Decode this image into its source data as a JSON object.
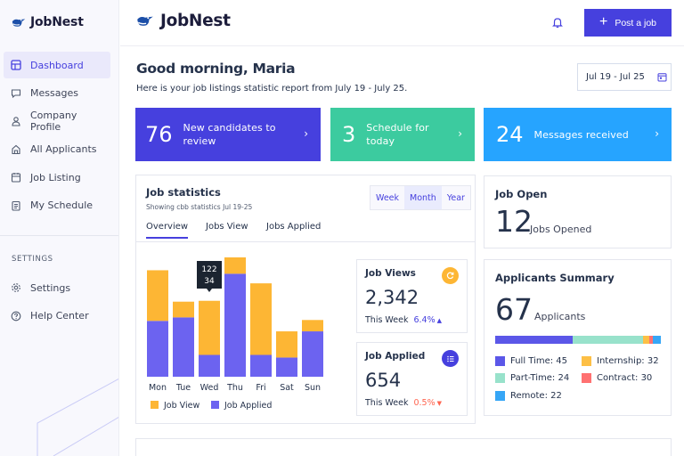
{
  "app": {
    "name": "JobNest"
  },
  "sidebar": {
    "items": [
      {
        "label": "Dashboard",
        "icon": "dashboard-icon",
        "active": true
      },
      {
        "label": "Messages",
        "icon": "message-icon",
        "active": false
      },
      {
        "label": "Company Profile",
        "icon": "building-icon",
        "active": false
      },
      {
        "label": "All Applicants",
        "icon": "users-icon",
        "active": false
      },
      {
        "label": "Job Listing",
        "icon": "clipboard-icon",
        "active": false
      },
      {
        "label": "My Schedule",
        "icon": "calendar-icon",
        "active": false
      }
    ],
    "settings_heading": "SETTINGS",
    "settings_items": [
      {
        "label": "Settings",
        "icon": "gear-icon"
      },
      {
        "label": "Help Center",
        "icon": "help-icon"
      }
    ]
  },
  "header": {
    "post_button": "Post a job"
  },
  "greeting": {
    "title": "Good morning, Maria",
    "subtitle": "Here is your job listings statistic report from July 19 - July 25.",
    "date_range": "Jul 19 - Jul 25"
  },
  "stats": [
    {
      "number": "76",
      "label": "New candidates to review",
      "color": "#4640DE"
    },
    {
      "number": "3",
      "label": "Schedule for today",
      "color": "#3CCB9F"
    },
    {
      "number": "24",
      "label": "Messages received",
      "color": "#26A4FF"
    }
  ],
  "job_statistics": {
    "title": "Job statistics",
    "subtitle": "Showing cbb statistics Jul 19-25",
    "periods": [
      "Week",
      "Month",
      "Year"
    ],
    "tabs": [
      "Overview",
      "Jobs View",
      "Jobs Applied"
    ],
    "tooltip": {
      "top": "122",
      "bottom": "34"
    },
    "legend": [
      "Job View",
      "Job Applied"
    ],
    "job_views": {
      "title": "Job Views",
      "value": "2,342",
      "period": "This Week",
      "change": "6.4%"
    },
    "job_applied": {
      "title": "Job Applied",
      "value": "654",
      "period": "This Week",
      "change": "0.5%"
    }
  },
  "chart_data": {
    "type": "bar",
    "stacked": true,
    "categories": [
      "Mon",
      "Tue",
      "Wed",
      "Thu",
      "Fri",
      "Sat",
      "Sun"
    ],
    "series": [
      {
        "name": "Job Applied",
        "values": [
          64,
          68,
          25,
          118,
          25,
          22,
          52
        ],
        "color": "#6C63F0"
      },
      {
        "name": "Job View",
        "values": [
          58,
          18,
          62,
          30,
          82,
          30,
          13
        ],
        "color": "#FDB634"
      }
    ],
    "ylim": [
      0,
      130
    ],
    "legend_position": "bottom"
  },
  "job_open": {
    "title": "Job Open",
    "number": "12",
    "unit": "Jobs Opened"
  },
  "applicants": {
    "title": "Applicants Summary",
    "number": "67",
    "unit": "Applicants",
    "breakdown": [
      {
        "label": "Full Time: 45",
        "value": 45,
        "color": "#5B57E8"
      },
      {
        "label": "Part-Time: 24",
        "value": 24,
        "color": "#98E2CB"
      },
      {
        "label": "Remote: 22",
        "value": 22,
        "color": "#36A6F6"
      },
      {
        "label": "Internship: 32",
        "value": 32,
        "color": "#FDBF45"
      },
      {
        "label": "Contract: 30",
        "value": 30,
        "color": "#FF7171"
      }
    ]
  }
}
